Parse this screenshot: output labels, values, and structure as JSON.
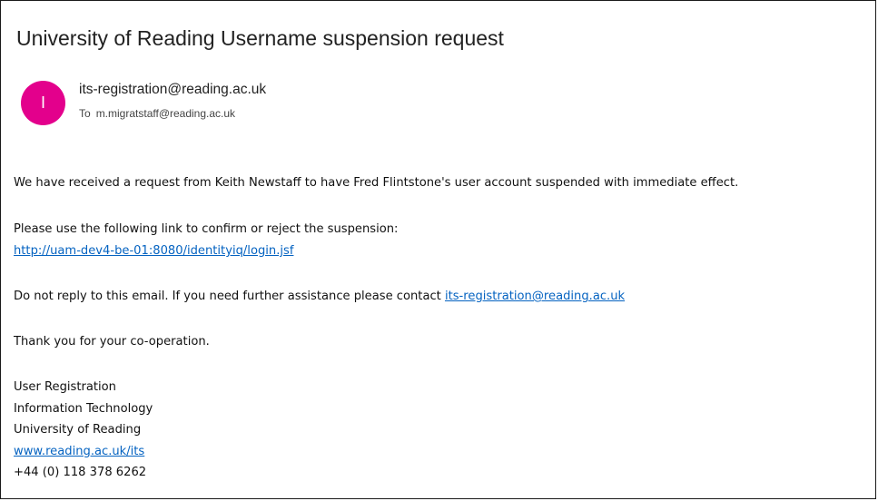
{
  "email": {
    "subject": "University of Reading Username suspension request",
    "sender": {
      "avatar_initial": "I",
      "avatar_color": "#e3008c",
      "address": "its-registration@reading.ac.uk"
    },
    "recipient": {
      "label": "To",
      "address": "m.migratstaff@reading.ac.uk"
    },
    "body": {
      "paragraph1": "We have received a request from Keith Newstaff to have Fred Flintstone's user account suspended with immediate effect.",
      "paragraph2": "Please use the following link to confirm or reject the suspension:",
      "confirm_link": "http://uam-dev4-be-01:8080/identityiq/login.jsf",
      "paragraph3_prefix": "Do not reply to this email. If you need further assistance please contact ",
      "contact_link": "its-registration@reading.ac.uk",
      "paragraph4": "Thank you for your co-operation."
    },
    "signature": {
      "line1": "User Registration",
      "line2": "Information Technology",
      "line3": "University of Reading",
      "website_link": "www.reading.ac.uk/its",
      "phone": "+44 (0) 118 378 6262"
    }
  },
  "colors": {
    "link": "#0563c1",
    "avatar": "#e3008c"
  }
}
